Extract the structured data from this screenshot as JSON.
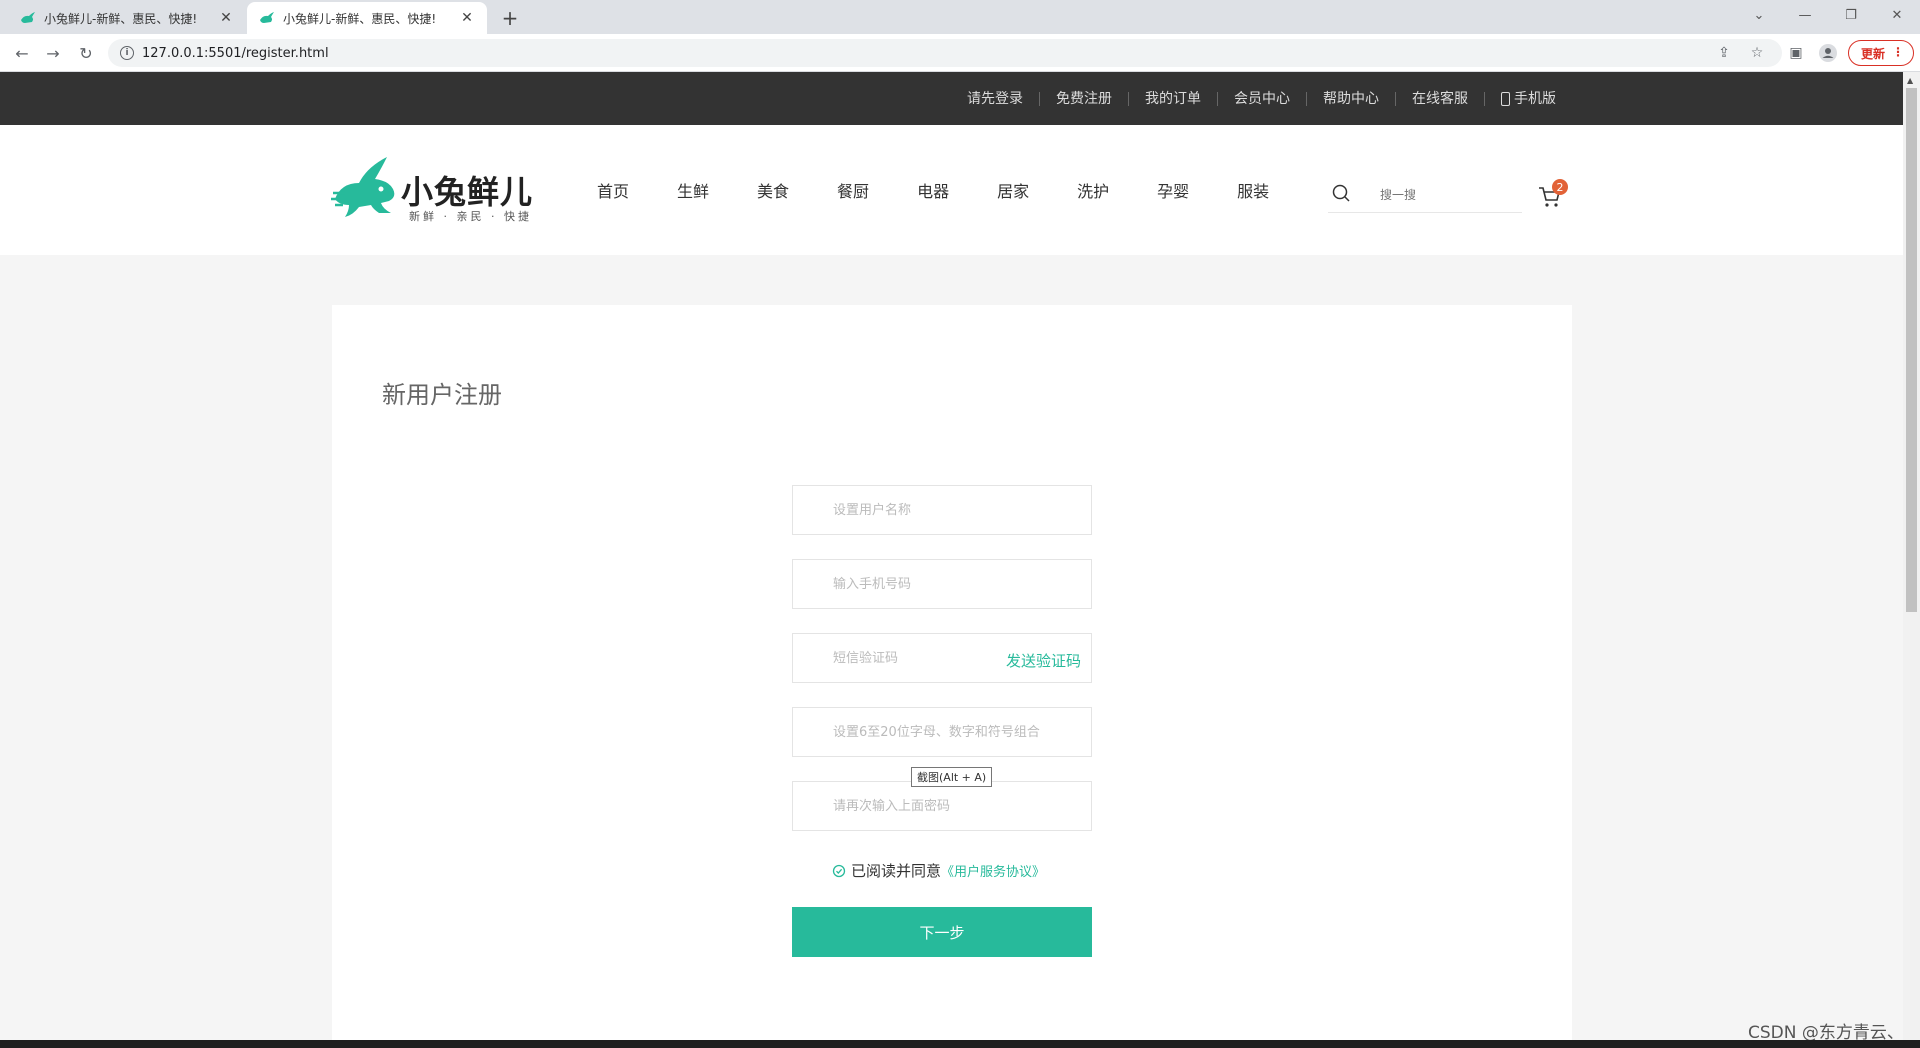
{
  "browser": {
    "tabs": [
      {
        "title": "小兔鲜儿-新鲜、惠民、快捷!",
        "active": false
      },
      {
        "title": "小兔鲜儿-新鲜、惠民、快捷!",
        "active": true
      }
    ],
    "url": "127.0.0.1:5501/register.html",
    "update_label": "更新",
    "accent_color": "#27ba9b"
  },
  "topbar": {
    "links": [
      "请先登录",
      "免费注册",
      "我的订单",
      "会员中心",
      "帮助中心",
      "在线客服",
      "手机版"
    ]
  },
  "header": {
    "logo_text": "小兔鲜儿",
    "logo_sub": "新鲜 · 亲民 · 快捷",
    "nav": [
      "首页",
      "生鲜",
      "美食",
      "餐厨",
      "电器",
      "居家",
      "洗护",
      "孕婴",
      "服装"
    ],
    "search_placeholder": "搜一搜",
    "cart_count": "2"
  },
  "register": {
    "title": "新用户注册",
    "fields": [
      {
        "placeholder": "设置用户名称"
      },
      {
        "placeholder": "输入手机号码"
      },
      {
        "placeholder": "短信验证码"
      },
      {
        "placeholder": "设置6至20位字母、数字和符号组合"
      },
      {
        "placeholder": "请再次输入上面密码"
      }
    ],
    "send_code": "发送验证码",
    "agree_text": "已阅读并同意",
    "agree_link": "《用户服务协议》",
    "submit": "下一步"
  },
  "tooltip": "截图(Alt + A)",
  "watermark": "CSDN @东方青云、"
}
